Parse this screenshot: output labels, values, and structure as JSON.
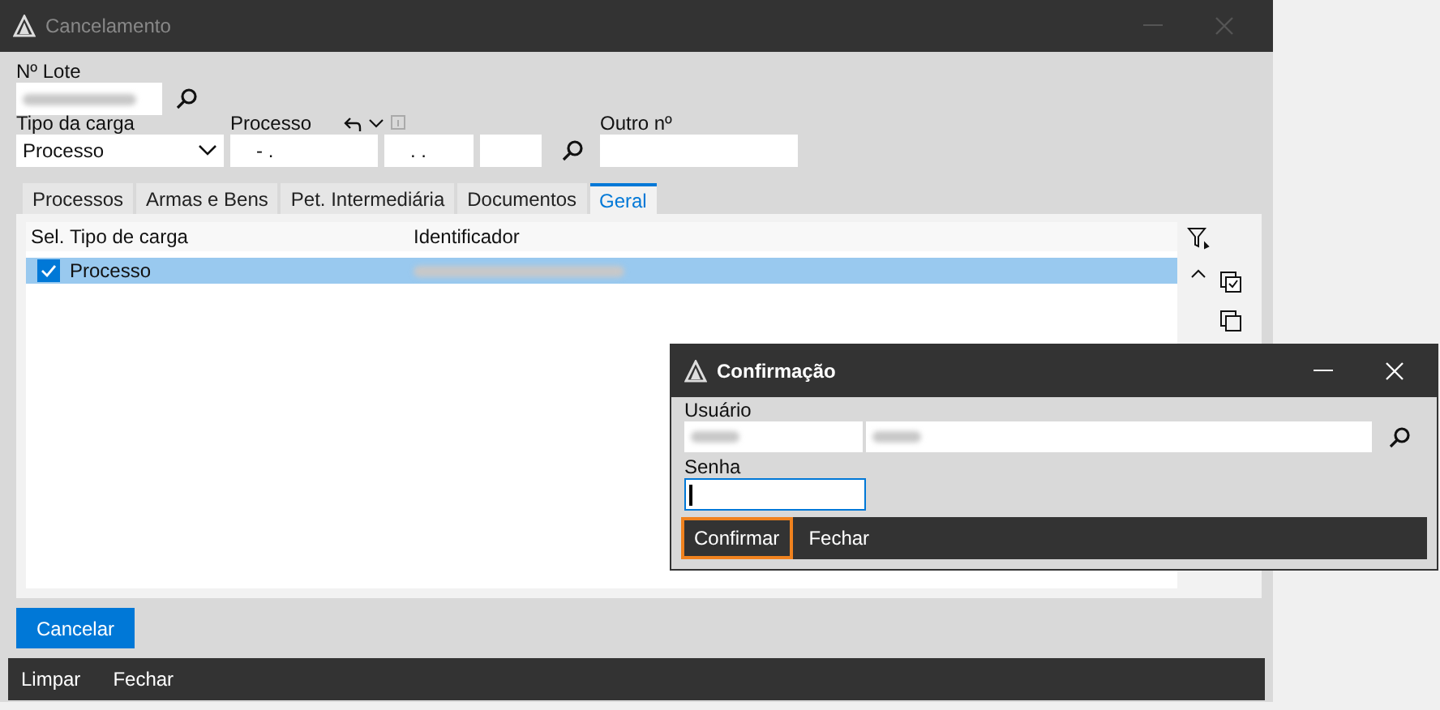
{
  "window": {
    "title": "Cancelamento"
  },
  "lote": {
    "label": "Nº Lote"
  },
  "tipo_carga": {
    "label": "Tipo da carga",
    "value": "Processo"
  },
  "processo": {
    "label": "Processo",
    "fields": [
      "-  .",
      ". ."
    ]
  },
  "outro": {
    "label": "Outro nº"
  },
  "tabs": [
    {
      "label": "Processos",
      "selected": false
    },
    {
      "label": "Armas e Bens",
      "selected": false
    },
    {
      "label": "Pet. Intermediária",
      "selected": false
    },
    {
      "label": "Documentos",
      "selected": false
    },
    {
      "label": "Geral",
      "selected": true
    }
  ],
  "table": {
    "columns": [
      "Sel.",
      "Tipo de carga",
      "Identificador"
    ],
    "rows": [
      {
        "checked": true,
        "selected": true,
        "tipo": "Processo"
      }
    ]
  },
  "primary_button": "Cancelar",
  "bottom_bar": [
    "Limpar",
    "Fechar"
  ],
  "dialog": {
    "title": "Confirmação",
    "usuario_label": "Usuário",
    "senha_label": "Senha",
    "buttons": [
      {
        "label": "Confirmar",
        "focused": true
      },
      {
        "label": "Fechar",
        "focused": false
      }
    ]
  }
}
